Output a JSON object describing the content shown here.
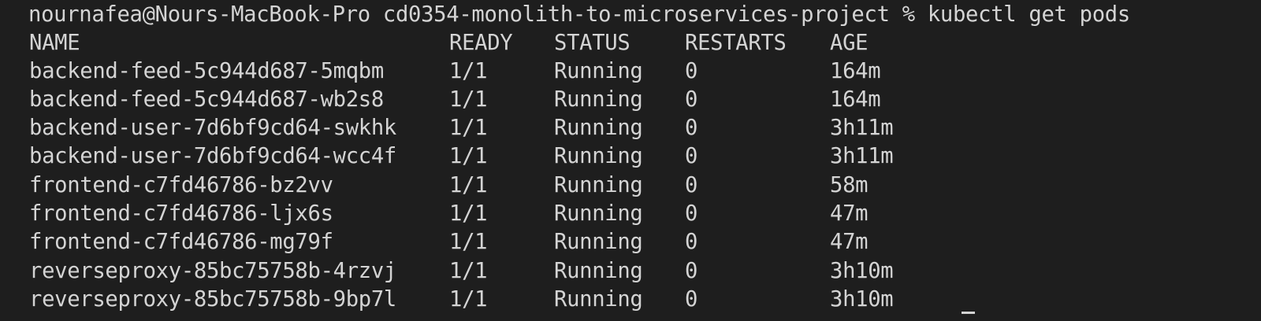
{
  "terminal": {
    "prompt": "nournafea@Nours-MacBook-Pro cd0354-monolith-to-microservices-project % kubectl get pods",
    "headers": {
      "name": "NAME",
      "ready": "READY",
      "status": "STATUS",
      "restarts": "RESTARTS",
      "age": "AGE"
    },
    "pods": [
      {
        "name": "backend-feed-5c944d687-5mqbm",
        "ready": "1/1",
        "status": "Running",
        "restarts": "0",
        "age": "164m"
      },
      {
        "name": "backend-feed-5c944d687-wb2s8",
        "ready": "1/1",
        "status": "Running",
        "restarts": "0",
        "age": "164m"
      },
      {
        "name": "backend-user-7d6bf9cd64-swkhk",
        "ready": "1/1",
        "status": "Running",
        "restarts": "0",
        "age": "3h11m"
      },
      {
        "name": "backend-user-7d6bf9cd64-wcc4f",
        "ready": "1/1",
        "status": "Running",
        "restarts": "0",
        "age": "3h11m"
      },
      {
        "name": "frontend-c7fd46786-bz2vv",
        "ready": "1/1",
        "status": "Running",
        "restarts": "0",
        "age": "58m"
      },
      {
        "name": "frontend-c7fd46786-ljx6s",
        "ready": "1/1",
        "status": "Running",
        "restarts": "0",
        "age": "47m"
      },
      {
        "name": "frontend-c7fd46786-mg79f",
        "ready": "1/1",
        "status": "Running",
        "restarts": "0",
        "age": "47m"
      },
      {
        "name": "reverseproxy-85bc75758b-4rzvj",
        "ready": "1/1",
        "status": "Running",
        "restarts": "0",
        "age": "3h10m"
      },
      {
        "name": "reverseproxy-85bc75758b-9bp7l",
        "ready": "1/1",
        "status": "Running",
        "restarts": "0",
        "age": "3h10m"
      }
    ]
  },
  "colors": {
    "background": "#1e1e1e",
    "foreground": "#d4d4d4"
  }
}
